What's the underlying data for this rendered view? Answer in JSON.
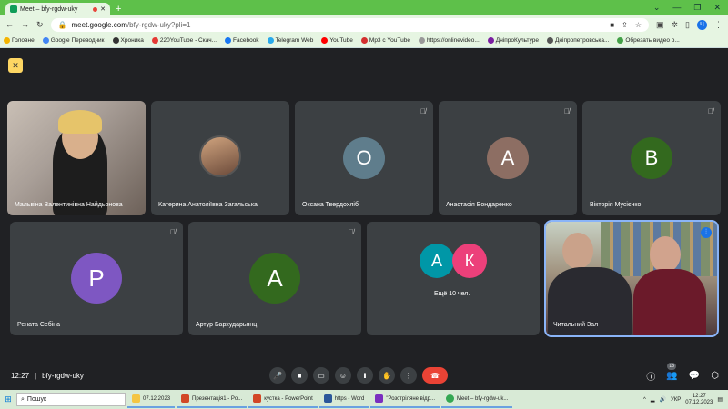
{
  "browser": {
    "tab_title": "Meet – bfy-rgdw-uky",
    "new_tab": "+",
    "url_host": "meet.google.com",
    "url_path": "/bfy-rgdw-uky?pli=1",
    "profile_initial": "Ч",
    "bookmarks": [
      "Головне",
      "Google Переводчик",
      "Хроника",
      "220YouTube - Скач...",
      "Facebook",
      "Telegram Web",
      "YouTube",
      "Mp3 с YouTube",
      "https://onlinevideo...",
      "ДніпроКультуре",
      "Дніпропетровська...",
      "Обрезать видео о..."
    ]
  },
  "tiles_row1": [
    {
      "name": "Мальвіна Валентинівна Найдьонова",
      "type": "video"
    },
    {
      "name": "Катерина Анатоліївна Загальська",
      "type": "photo"
    },
    {
      "name": "Оксана Твердохліб",
      "initial": "О",
      "color": "#5f7d8c"
    },
    {
      "name": "Анастасія Бондаренко",
      "initial": "А",
      "color": "#8d6e63"
    },
    {
      "name": "Вікторія Мусієнко",
      "initial": "В",
      "color": "#33691e"
    }
  ],
  "tiles_row2": [
    {
      "name": "Рената Себіна",
      "initial": "Р",
      "color": "#7e57c2"
    },
    {
      "name": "Артур Бархударьянц",
      "initial": "А",
      "color": "#33691e"
    },
    {
      "name": "",
      "more_text": "Ещё 10 чел.",
      "initial_a": "А",
      "initial_k": "К",
      "color_a": "#0097a7",
      "color_k": "#ec407a"
    },
    {
      "name": "Читальний Зал",
      "type": "video"
    }
  ],
  "bottom": {
    "time": "12:27",
    "separator": "|",
    "meeting_code": "bfy-rgdw-uky",
    "participants_count": "18"
  },
  "taskbar": {
    "search_label": "Пошук",
    "tasks": [
      "07.12.2023",
      "Презентація1 - Po...",
      "кустка - PowerPoint",
      "https - Word",
      "\"Розстріляне відр...",
      "Meet – bfy-rgdw-uk..."
    ],
    "lang": "УКР",
    "time": "12:27",
    "date": "07.12.2023"
  }
}
